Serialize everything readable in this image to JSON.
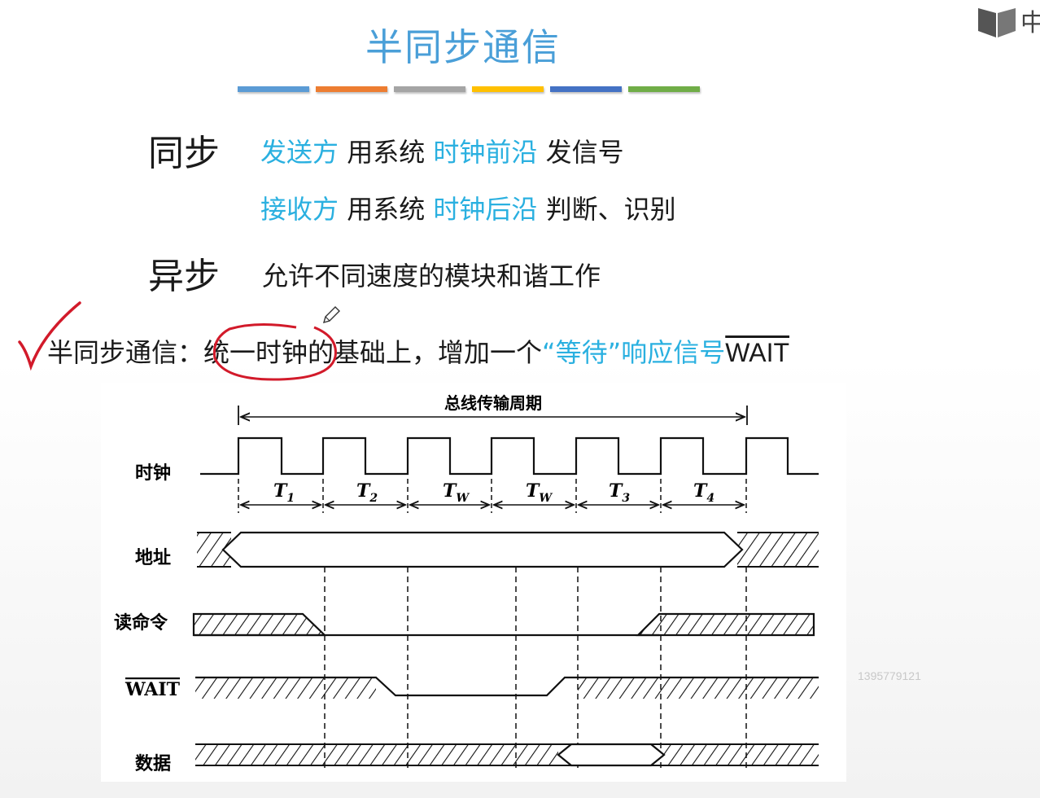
{
  "slide": {
    "title": "半同步通信",
    "bar_colors": [
      "#5b9bd5",
      "#ed7d31",
      "#a5a5a5",
      "#ffc000",
      "#4472c4",
      "#70ad47"
    ]
  },
  "sync": {
    "heading": "同步",
    "line1": {
      "a": "发送方",
      "b": " 用系统 ",
      "c": "时钟前沿",
      "d": " 发信号"
    },
    "line2": {
      "a": "接收方",
      "b": " 用系统 ",
      "c": "时钟后沿",
      "d": " 判断、识别"
    }
  },
  "async": {
    "heading": "异步",
    "text": "允许不同速度的模块和谐工作"
  },
  "semi": {
    "prefix": "半同步通信：",
    "circled": "统一时钟",
    "middle": "的基础上，增加一个",
    "quote": "“等待”",
    "suffix": "响应信号",
    "signal": "WAIT"
  },
  "diagram": {
    "period_label": "总线传输周期",
    "row_labels": {
      "clock": "时钟",
      "address": "地址",
      "read": "读命令",
      "wait": "WAIT",
      "data": "数据"
    },
    "phases": [
      {
        "main": "T",
        "sub": "1"
      },
      {
        "main": "T",
        "sub": "2"
      },
      {
        "main": "T",
        "sub": "W"
      },
      {
        "main": "T",
        "sub": "W"
      },
      {
        "main": "T",
        "sub": "3"
      },
      {
        "main": "T",
        "sub": "4"
      }
    ]
  },
  "watermark": "1395779121",
  "corner_label": "中",
  "icons": [
    "checkmark-annotation",
    "pen-cursor-icon",
    "book-icon"
  ]
}
